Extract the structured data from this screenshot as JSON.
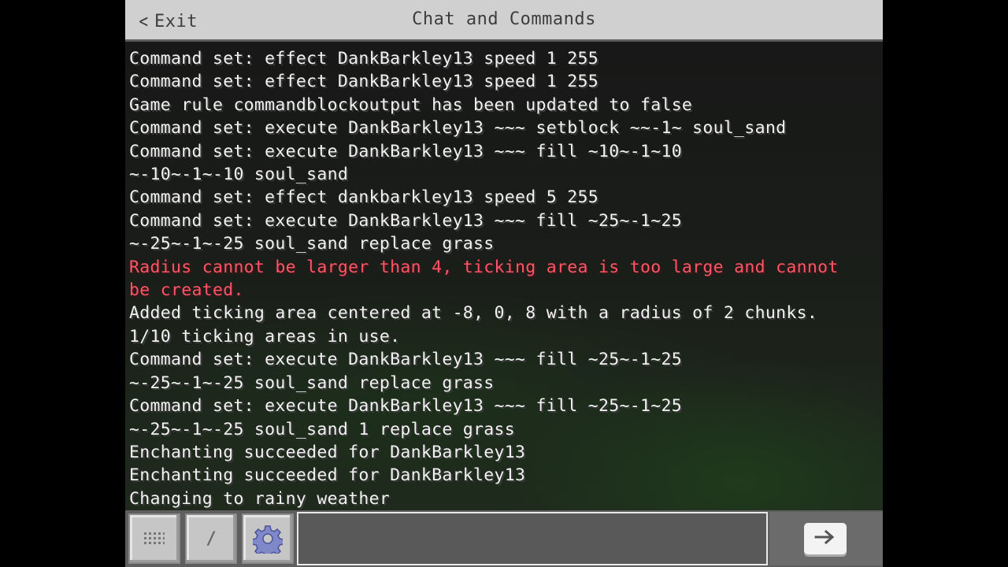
{
  "header": {
    "exit_label": "Exit",
    "title": "Chat and Commands"
  },
  "log": [
    {
      "text": "Command set: effect DankBarkley13 speed 1 255",
      "type": "normal"
    },
    {
      "text": "Command set: effect DankBarkley13 speed 1 255",
      "type": "normal"
    },
    {
      "text": "Game rule commandblockoutput has been updated to false",
      "type": "normal"
    },
    {
      "text": "Command set: execute DankBarkley13 ~~~ setblock ~~-1~ soul_sand",
      "type": "normal"
    },
    {
      "text": "Command set: execute DankBarkley13 ~~~ fill ~10~-1~10",
      "type": "normal"
    },
    {
      "text": "~-10~-1~-10 soul_sand",
      "type": "normal"
    },
    {
      "text": "Command set: effect dankbarkley13 speed 5 255",
      "type": "normal"
    },
    {
      "text": "Command set: execute DankBarkley13 ~~~ fill ~25~-1~25",
      "type": "normal"
    },
    {
      "text": "~-25~-1~-25 soul_sand replace grass",
      "type": "normal"
    },
    {
      "text": "Radius cannot be larger than 4, ticking area is too large and cannot",
      "type": "error"
    },
    {
      "text": "be created.",
      "type": "error"
    },
    {
      "text": "Added ticking area centered at -8, 0, 8 with a radius of 2 chunks.",
      "type": "normal"
    },
    {
      "text": "1/10 ticking areas in use.",
      "type": "normal"
    },
    {
      "text": "Command set: execute DankBarkley13 ~~~ fill ~25~-1~25",
      "type": "normal"
    },
    {
      "text": "~-25~-1~-25 soul_sand replace grass",
      "type": "normal"
    },
    {
      "text": "Command set: execute DankBarkley13 ~~~ fill ~25~-1~25",
      "type": "normal"
    },
    {
      "text": "~-25~-1~-25 soul_sand 1 replace grass",
      "type": "normal"
    },
    {
      "text": "Enchanting succeeded for DankBarkley13",
      "type": "normal"
    },
    {
      "text": "Enchanting succeeded for DankBarkley13",
      "type": "normal"
    },
    {
      "text": "Changing to rainy weather",
      "type": "normal"
    }
  ],
  "toolbar": {
    "keyboard_icon": "keyboard-icon",
    "slash_label": "/",
    "settings_icon": "gear-icon",
    "send_icon": "arrow-right-icon"
  },
  "input": {
    "value": "",
    "placeholder": ""
  },
  "colors": {
    "normal_text": "#f2f2f2",
    "error_text": "#ff5566",
    "header_bg": "#d0d0d0"
  }
}
